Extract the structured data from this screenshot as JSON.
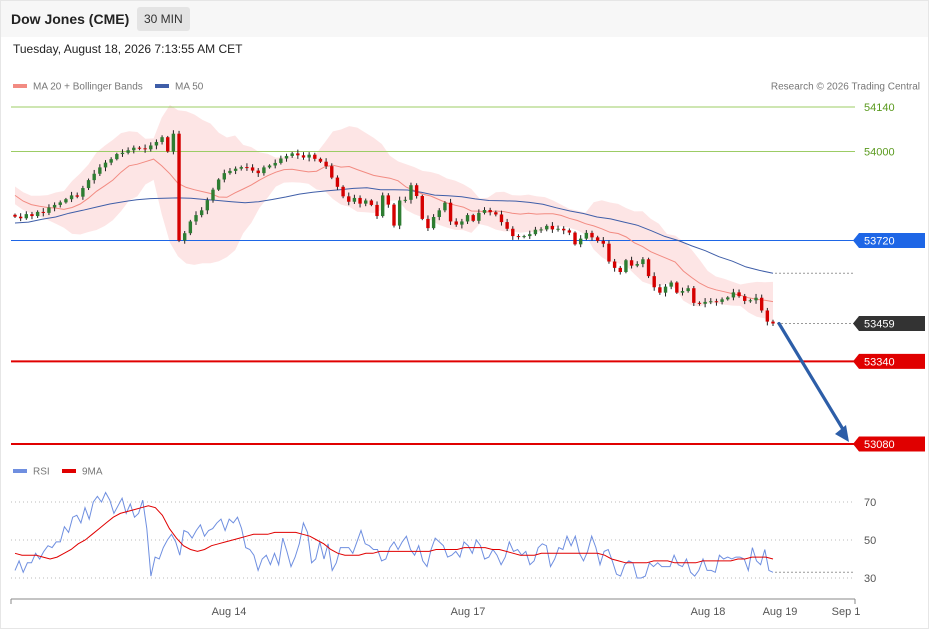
{
  "header": {
    "symbol": "Dow Jones (CME)",
    "interval": "30 MIN",
    "timestamp": "Tuesday, August 18, 2026 7:13:55 AM CET"
  },
  "legend": {
    "ma20": "MA 20 + Bollinger Bands",
    "ma50": "MA 50",
    "credit": "Research © 2026 Trading Central",
    "rsi": "RSI",
    "rsi_ma": "9MA"
  },
  "colors": {
    "ma20": "#f28b82",
    "band": "#fde0e0",
    "ma50": "#3f5ea8",
    "bull": "#2e7d32",
    "bear": "#d50000",
    "resistance": "#9ccc65",
    "pivot": "#1e66e6",
    "support": "#e00000",
    "last": "#333333",
    "arrow": "#2d5ea8",
    "rsi": "#6f8fe0",
    "rsi_ma": "#e00000"
  },
  "chart_data": [
    {
      "type": "candlestick",
      "panel": "price",
      "x_labels": [
        "Aug 14",
        "Aug 17",
        "Aug 18",
        "Aug 19",
        "Sep 1"
      ],
      "y_scale": {
        "ref_value_top": 54140,
        "ref_value_bottom": 53080
      },
      "price_levels": [
        {
          "value": 54140,
          "label": "54140",
          "kind": "resistance"
        },
        {
          "value": 54000,
          "label": "54000",
          "kind": "resistance"
        },
        {
          "value": 53720,
          "label": "53720",
          "kind": "pivot"
        },
        {
          "value": 53459,
          "label": "53459",
          "kind": "last"
        },
        {
          "value": 53340,
          "label": "53340",
          "kind": "support"
        },
        {
          "value": 53080,
          "label": "53080",
          "kind": "support"
        }
      ],
      "close": [
        53795,
        53790,
        53803,
        53797,
        53810,
        53807,
        53824,
        53832,
        53840,
        53850,
        53862,
        53858,
        53885,
        53910,
        53930,
        53950,
        53965,
        53976,
        53992,
        53996,
        54004,
        54012,
        54010,
        54007,
        54019,
        54030,
        54045,
        54000,
        54056,
        53720,
        53743,
        53780,
        53800,
        53815,
        53847,
        53880,
        53912,
        53932,
        53939,
        53946,
        53951,
        53950,
        53940,
        53932,
        53950,
        53956,
        53964,
        53978,
        53986,
        53994,
        53988,
        53981,
        53990,
        53977,
        53968,
        53954,
        53918,
        53889,
        53859,
        53842,
        53854,
        53836,
        53846,
        53832,
        53797,
        53862,
        53833,
        53767,
        53846,
        53848,
        53894,
        53860,
        53788,
        53759,
        53794,
        53815,
        53839,
        53780,
        53770,
        53780,
        53800,
        53782,
        53807,
        53816,
        53809,
        53802,
        53778,
        53757,
        53734,
        53731,
        53734,
        53740,
        53754,
        53755,
        53766,
        53755,
        53757,
        53752,
        53745,
        53708,
        53726,
        53744,
        53730,
        53719,
        53710,
        53654,
        53634,
        53621,
        53658,
        53641,
        53646,
        53661,
        53608,
        53573,
        53556,
        53575,
        53588,
        53556,
        53561,
        53570,
        53524,
        53521,
        53527,
        53529,
        53527,
        53535,
        53541,
        53557,
        53545,
        53530,
        53532,
        53540,
        53500,
        53465,
        53459
      ],
      "ma20": [
        53862,
        53844,
        53833,
        53828,
        53824,
        53822,
        53818,
        53824,
        53835,
        53853,
        53875,
        53892,
        53910,
        53935,
        53955,
        53960,
        53968,
        53976,
        53955,
        53930,
        53900,
        53887,
        53880,
        53874,
        53868,
        53857,
        53856,
        53870,
        53882,
        53895,
        53910,
        53924,
        53935,
        53943,
        53944,
        53940,
        53936,
        53938,
        53952,
        53957,
        53951,
        53953,
        53943,
        53934,
        53925,
        53920,
        53916,
        53908,
        53888,
        53877,
        53866,
        53860,
        53849,
        53838,
        53831,
        53825,
        53813,
        53812,
        53810,
        53813,
        53811,
        53806,
        53803,
        53806,
        53803,
        53804,
        53804,
        53799,
        53790,
        53783,
        53773,
        53766,
        53757,
        53746,
        53742,
        53731,
        53713,
        53701,
        53685,
        53674,
        53663,
        53652,
        53624,
        53604,
        53586,
        53573,
        53565,
        53559,
        53553,
        53548,
        53540,
        53535,
        53532,
        53528
      ],
      "ma50": [
        53775,
        53778,
        53787,
        53794,
        53806,
        53815,
        53825,
        53835,
        53842,
        53848,
        53852,
        53853,
        53854,
        53853,
        53849,
        53846,
        53842,
        53839,
        53842,
        53849,
        53857,
        53866,
        53872,
        53876,
        53880,
        53884,
        53886,
        53880,
        53880,
        53879,
        53872,
        53863,
        53861,
        53858,
        53851,
        53846,
        53845,
        53844,
        53840,
        53834,
        53823,
        53813,
        53805,
        53794,
        53788,
        53778,
        53768,
        53751,
        53733,
        53720,
        53703,
        53688,
        53669,
        53655,
        53637,
        53626,
        53617
      ]
    },
    {
      "type": "line",
      "panel": "rsi",
      "y_ticks": [
        70,
        50,
        30
      ],
      "series": [
        {
          "name": "RSI",
          "values": [
            34,
            39,
            33,
            38,
            38,
            43,
            40,
            44,
            47,
            46,
            49,
            49,
            57,
            54,
            62,
            63,
            59,
            67,
            61,
            70,
            73,
            70,
            75,
            71,
            64,
            68,
            72,
            64,
            69,
            62,
            64,
            71,
            56,
            31,
            41,
            40,
            46,
            50,
            53,
            49,
            42,
            55,
            54,
            51,
            55,
            58,
            52,
            55,
            56,
            59,
            61,
            55,
            61,
            59,
            62,
            56,
            46,
            45,
            42,
            34,
            40,
            42,
            37,
            43,
            37,
            51,
            44,
            36,
            41,
            48,
            59,
            54,
            38,
            40,
            49,
            40,
            48,
            34,
            38,
            46,
            46,
            46,
            43,
            49,
            55,
            48,
            47,
            45,
            45,
            39,
            40,
            46,
            49,
            45,
            49,
            52,
            45,
            42,
            47,
            39,
            36,
            45,
            51,
            49,
            47,
            41,
            42,
            44,
            41,
            49,
            47,
            43,
            50,
            47,
            40,
            41,
            45,
            42,
            37,
            41,
            49,
            44,
            45,
            42,
            44,
            37,
            39,
            46,
            48,
            47,
            36,
            40,
            46,
            45,
            52,
            47,
            52,
            43,
            39,
            44,
            52,
            46,
            37,
            44,
            45,
            39,
            32,
            31,
            37,
            39,
            38,
            30,
            30,
            31,
            38,
            36,
            38,
            36,
            36,
            36,
            42,
            37,
            36,
            40,
            33,
            31,
            34,
            40,
            34,
            34,
            33,
            42,
            40,
            41,
            40,
            41,
            41,
            40,
            34,
            46,
            39,
            37,
            45,
            34,
            33
          ]
        },
        {
          "name": "9MA",
          "values": [
            43,
            42,
            42,
            42,
            41,
            40,
            41,
            43,
            45,
            48,
            50,
            53,
            56,
            59,
            62,
            64,
            65,
            66,
            67,
            68,
            67,
            63,
            56,
            51,
            47,
            45,
            44,
            45,
            47,
            48,
            49,
            50,
            51,
            52,
            53,
            53,
            53,
            54,
            54,
            54,
            54,
            53,
            52,
            50,
            48,
            45,
            43,
            42,
            42,
            42,
            43,
            43,
            44,
            44,
            44,
            44,
            44,
            44,
            44,
            44,
            45,
            45,
            45,
            45,
            46,
            46,
            46,
            46,
            45,
            45,
            44,
            43,
            42,
            42,
            42,
            43,
            43,
            43,
            43,
            43,
            43,
            43,
            43,
            43,
            42,
            40,
            39,
            38,
            38,
            38,
            38,
            39,
            39,
            39,
            38,
            38,
            38,
            38,
            39,
            39,
            39,
            39,
            39,
            40,
            40,
            41,
            41,
            41,
            40
          ]
        }
      ]
    }
  ]
}
